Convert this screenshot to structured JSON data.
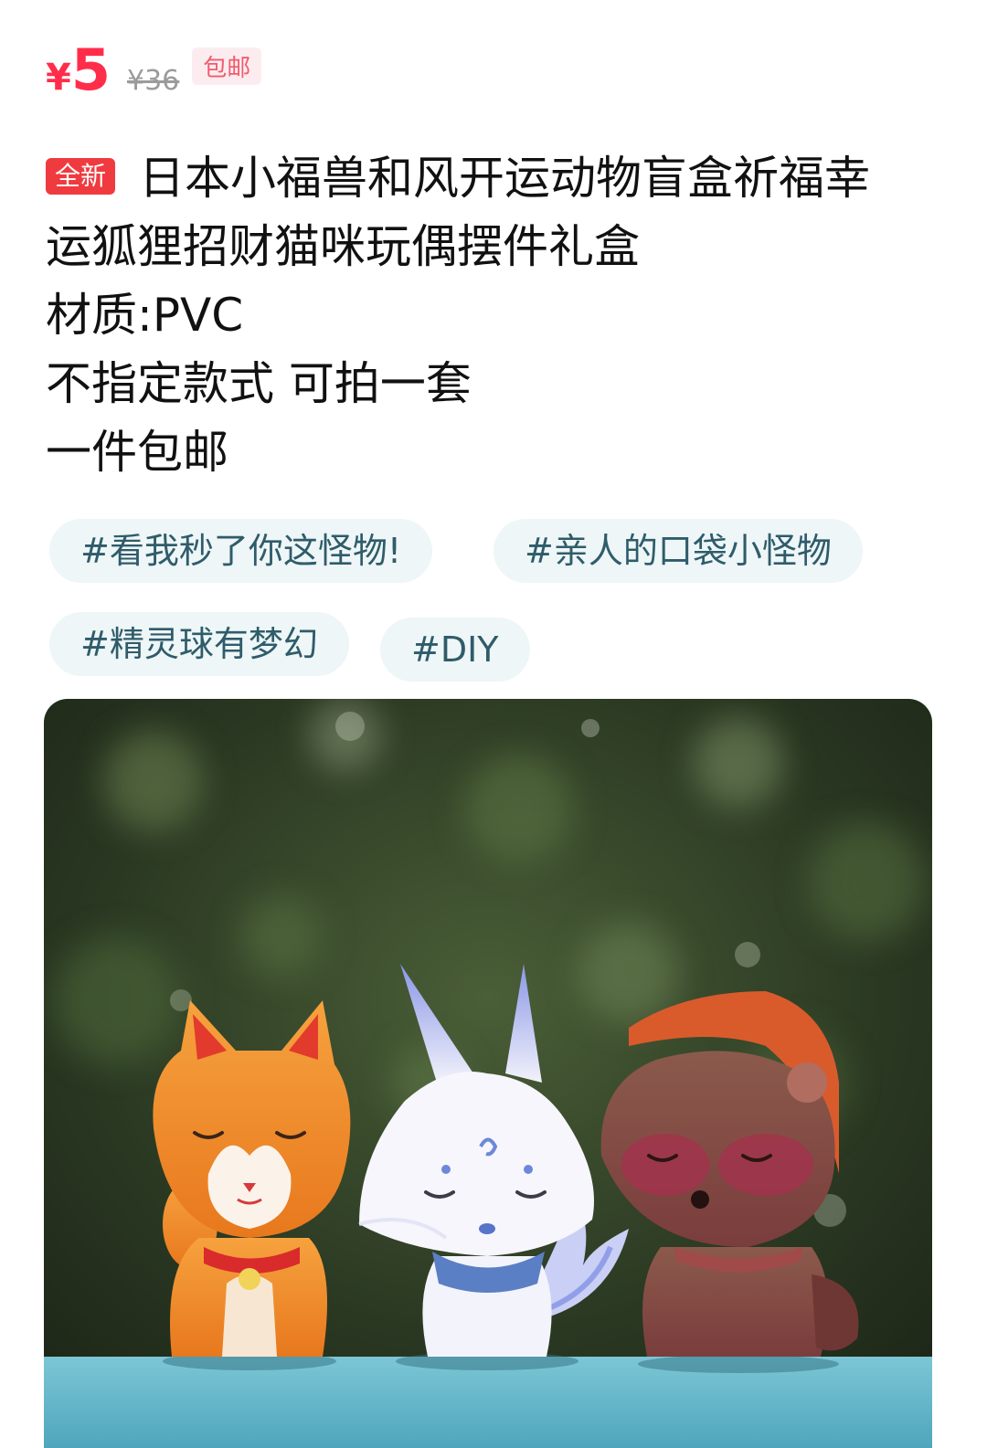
{
  "price": {
    "currency": "¥",
    "current": "5",
    "original": "¥36",
    "shipping_tag": "包邮"
  },
  "listing": {
    "condition_badge": "全新",
    "title_line1": "日本小福兽和风开运动物盲盒祈福幸",
    "title_line2": "运狐狸招财猫咪玩偶摆件礼盒",
    "material": "材质:PVC",
    "style_note": "不指定款式 可拍一套",
    "shipping_note": "一件包邮"
  },
  "tags": [
    "#看我秒了你这怪物!",
    "#亲人的口袋小怪物",
    "#精灵球有梦幻",
    "#DIY"
  ],
  "photo": {
    "description_icon": "product-photo-figurines",
    "colors": {
      "background": "#2c3a23",
      "table": "#5fb5c8",
      "cat": "#f08a2a",
      "fox": "#f2f2fb",
      "tanuki": "#8a4b45"
    }
  }
}
